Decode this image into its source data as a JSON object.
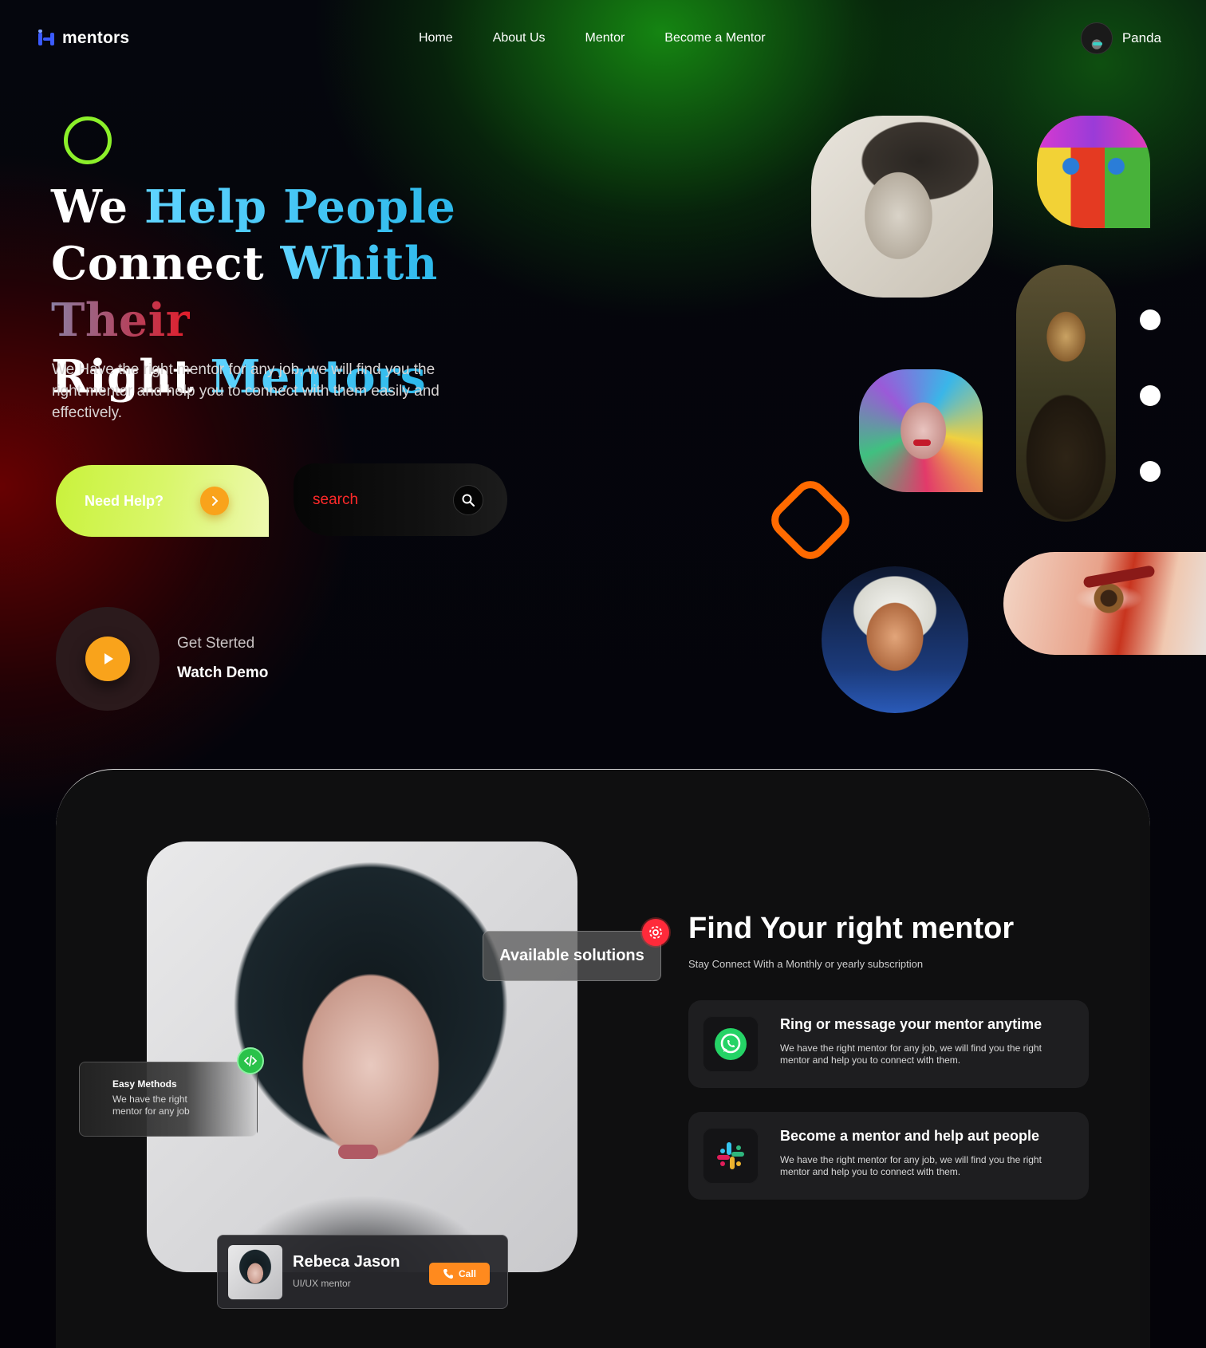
{
  "brand": {
    "name": "mentors",
    "accent": "#3b5bff"
  },
  "nav": {
    "items": [
      {
        "label": "Home"
      },
      {
        "label": "About Us"
      },
      {
        "label": "Mentor"
      },
      {
        "label": "Become a Mentor"
      }
    ]
  },
  "user": {
    "name": "Panda"
  },
  "hero": {
    "title_line1_a": "We ",
    "title_line1_b": "Help People",
    "title_line2_a": "Connect ",
    "title_line2_b": "Whith ",
    "title_line2_c": "Their",
    "title_line3_a": "Right ",
    "title_line3_b": "Mentors",
    "subtitle": "We Have the right mentor for any job, we will find you the right mentor and help you to connect with them easily and effectively.",
    "cta_label": "Need Help?",
    "search_placeholder": "search",
    "get_started": "Get Sterted",
    "watch_demo": "Watch Demo"
  },
  "gallery": {
    "images": [
      "sketch-woman-portrait",
      "colorful-cubist-face",
      "mona-lisa",
      "marilyn-pop-art",
      "einstein-painting",
      "painted-eye"
    ]
  },
  "showcase": {
    "available_label": "Available solutions",
    "easy_title": "Easy Methods",
    "easy_text": "We have the right mentor for any job",
    "mentor_name": "Rebeca Jason",
    "mentor_role": "UI/UX mentor",
    "call_label": "Call"
  },
  "find": {
    "title": "Find Your right mentor",
    "subtitle": "Stay Connect With a Monthly or yearly subscription",
    "features": [
      {
        "title": "Ring or message your mentor anytime",
        "text": "We have the right mentor for any job, we will find you the right mentor and help you to connect with them.",
        "icon": "whatsapp-icon"
      },
      {
        "title": "Become a mentor and help aut people",
        "text": "We have the right mentor for any job, we will find you the right mentor and help you to connect with them.",
        "icon": "slack-icon"
      }
    ]
  },
  "colors": {
    "lime": "#c9f23b",
    "orange": "#f9a31b",
    "ring": "#8cf02a",
    "diamond": "#ff6a00",
    "search_text": "#ff2a2a"
  }
}
